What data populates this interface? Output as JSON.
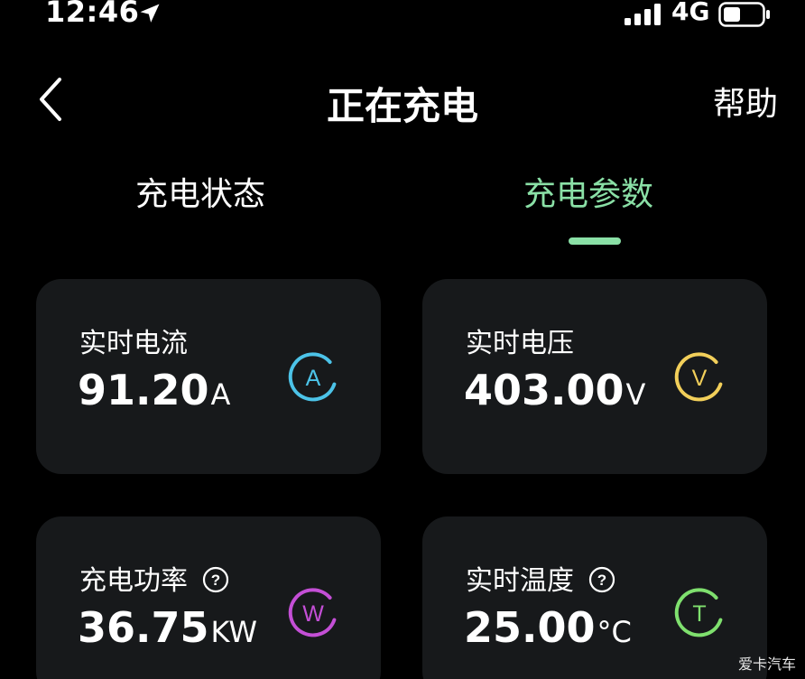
{
  "status_bar": {
    "time": "12:46",
    "network": "4G",
    "location_icon": "location-arrow-icon",
    "signal_icon": "signal-bars-icon",
    "battery_icon": "battery-icon"
  },
  "nav": {
    "title": "正在充电",
    "help_label": "帮助",
    "back_icon": "chevron-left-icon"
  },
  "tabs": [
    {
      "label": "充电状态",
      "active": false
    },
    {
      "label": "充电参数",
      "active": true
    }
  ],
  "colors": {
    "background": "#000000",
    "card": "#17191b",
    "accent_green": "#8ae0a6",
    "current_icon": "#4cc3e8",
    "voltage_icon": "#f2cf5a",
    "power_icon": "#c44fd6",
    "temperature_icon": "#7fe06e"
  },
  "cards": {
    "current": {
      "label": "实时电流",
      "value": "91.20",
      "unit": "A",
      "icon_letter": "A",
      "icon": "ampere-icon"
    },
    "voltage": {
      "label": "实时电压",
      "value": "403.00",
      "unit": "V",
      "icon_letter": "V",
      "icon": "volt-icon"
    },
    "power": {
      "label": "充电功率",
      "value": "36.75",
      "unit": "KW",
      "icon_letter": "W",
      "icon": "watt-icon",
      "help_icon": "question-circle-icon"
    },
    "temperature": {
      "label": "实时温度",
      "value": "25.00",
      "unit": "°C",
      "icon_letter": "T",
      "icon": "temperature-icon",
      "help_icon": "question-circle-icon"
    }
  },
  "watermark": "爱卡汽车"
}
